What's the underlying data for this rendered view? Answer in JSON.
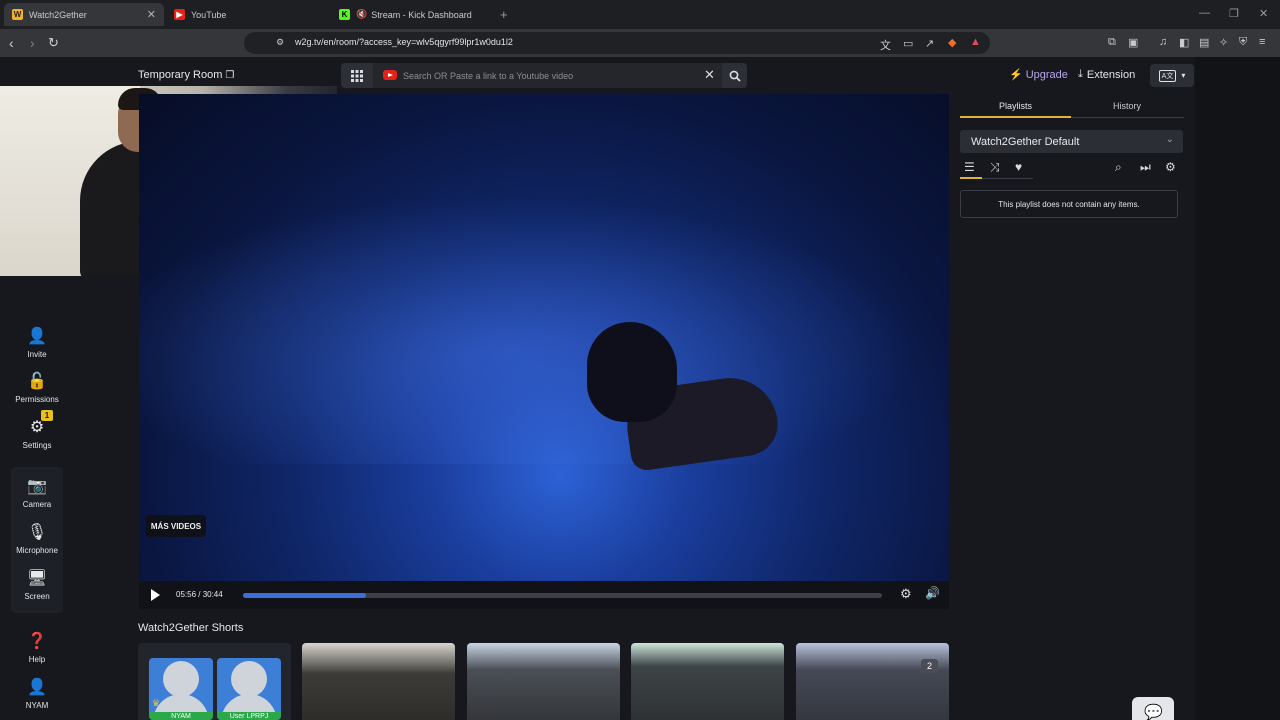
{
  "browser": {
    "tabs": [
      {
        "title": "Watch2Gether",
        "active": true
      },
      {
        "title": "YouTube",
        "active": false
      },
      {
        "title": "Stream - Kick Dashboard",
        "active": false
      }
    ],
    "new_tab": "+",
    "url": "w2g.tv/en/room/?access_key=wlv5qgyrf99lpr1w0du1l2"
  },
  "room": {
    "title": "Temporary Room"
  },
  "search": {
    "placeholder": "Search OR Paste a link to a Youtube video"
  },
  "header": {
    "upgrade_label": "Upgrade",
    "extension_label": "Extension"
  },
  "sidebar": {
    "items": [
      {
        "label": "Invite"
      },
      {
        "label": "Permissions"
      },
      {
        "label": "Settings",
        "badge": "1"
      },
      {
        "label": "Camera"
      },
      {
        "label": "Microphone"
      },
      {
        "label": "Screen"
      },
      {
        "label": "Help"
      },
      {
        "label": "NYAM"
      }
    ]
  },
  "player": {
    "overlay_label": "MÁS VIDEOS",
    "time": "05:56 / 30:44",
    "progress_fraction": 0.193
  },
  "shorts": {
    "title": "Watch2Gether Shorts",
    "badge": "2",
    "users": [
      "NYAM",
      "User LPRPJ"
    ]
  },
  "right_panel": {
    "tabs": [
      "Playlists",
      "History"
    ],
    "playlist_name": "Watch2Gether Default",
    "empty_message": "This playlist does not contain any items."
  },
  "colors": {
    "accent": "#e0b43c",
    "progress": "#3a6fd8",
    "upgrade": "#b9a6f0"
  }
}
